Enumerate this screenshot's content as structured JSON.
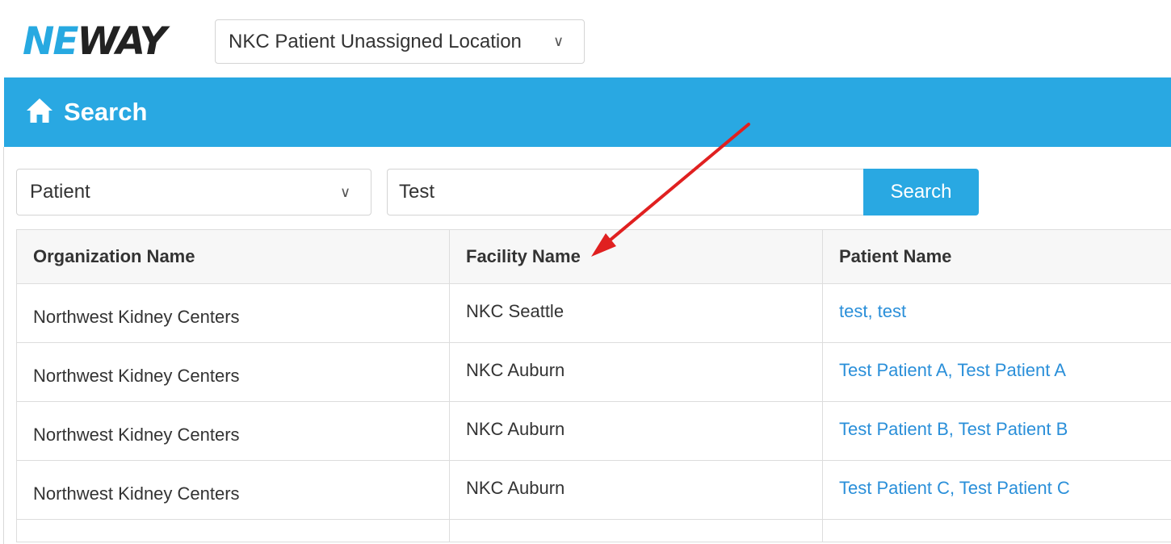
{
  "brand": {
    "logo_part1": "NE",
    "logo_part2": "W",
    "logo_part3": "AY"
  },
  "header": {
    "location_value": "NKC Patient Unassigned Location"
  },
  "banner": {
    "title": "Search"
  },
  "search": {
    "type_value": "Patient",
    "query": "Test",
    "button_label": "Search"
  },
  "table": {
    "columns": [
      "Organization Name",
      "Facility Name",
      "Patient Name"
    ],
    "rows": [
      {
        "org": "Northwest Kidney Centers",
        "facility": "NKC Seattle",
        "patient": "test, test"
      },
      {
        "org": "Northwest Kidney Centers",
        "facility": "NKC Auburn",
        "patient": "Test Patient A, Test Patient A"
      },
      {
        "org": "Northwest Kidney Centers",
        "facility": "NKC Auburn",
        "patient": "Test Patient B, Test Patient B"
      },
      {
        "org": "Northwest Kidney Centers",
        "facility": "NKC Auburn",
        "patient": "Test Patient C, Test Patient C"
      }
    ]
  },
  "colors": {
    "brand_blue": "#29a8e2",
    "link_blue": "#2a8fd9",
    "annotation_red": "#e02020"
  },
  "icons": {
    "home": "home-icon",
    "chevron": "chevron-down-icon"
  }
}
